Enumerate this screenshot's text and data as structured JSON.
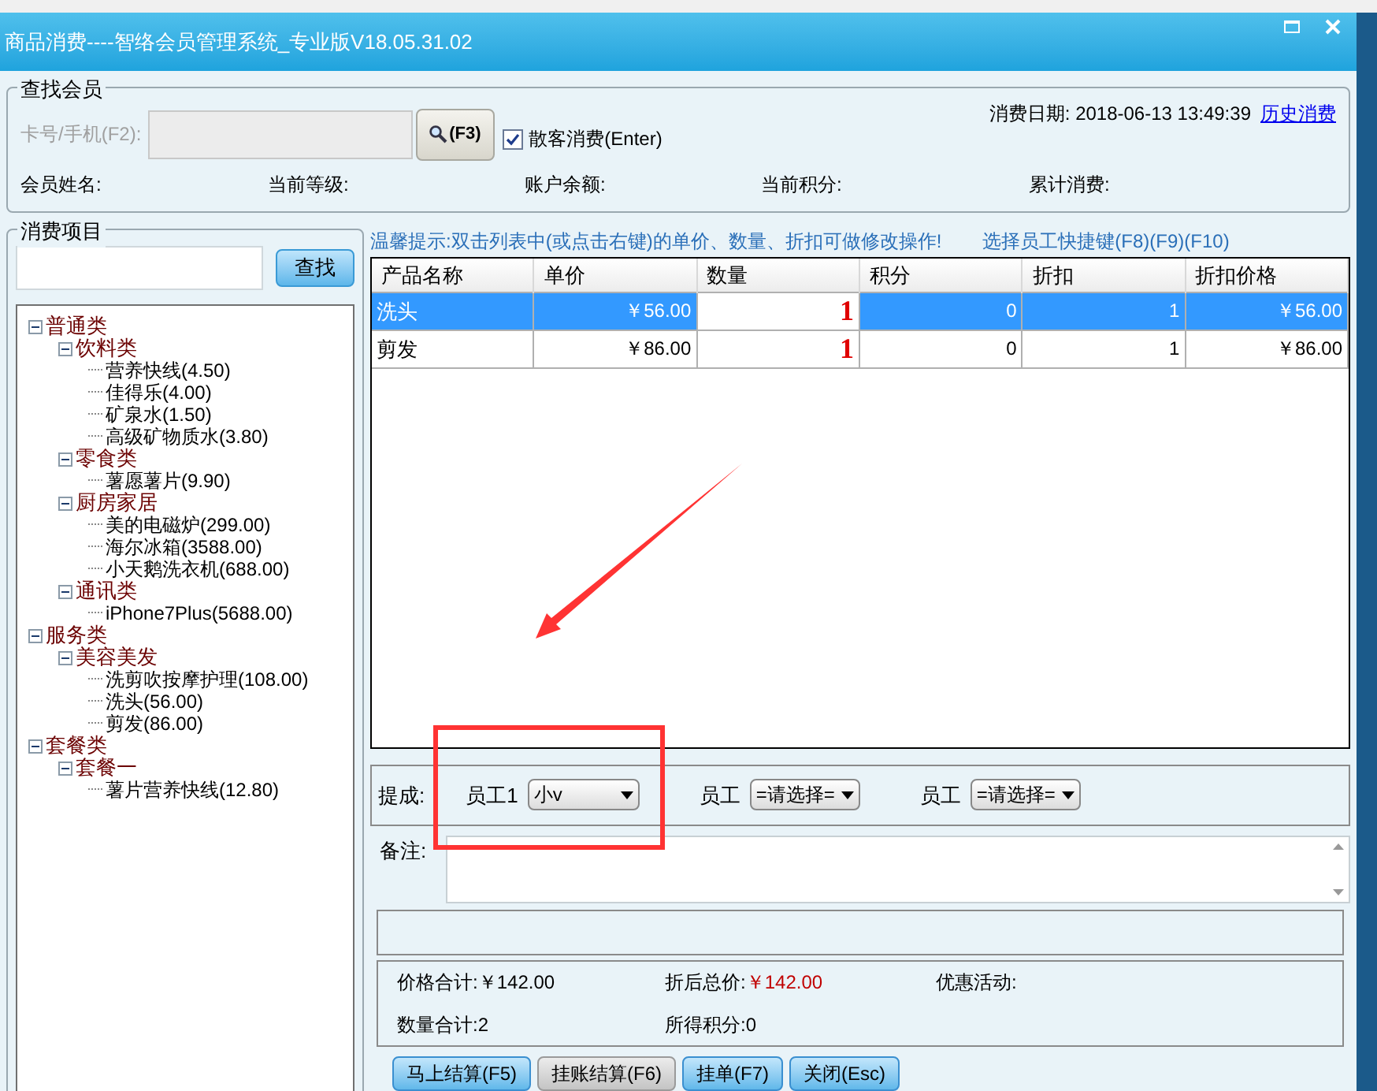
{
  "window": {
    "title": "商品消费----智络会员管理系统_专业版V18.05.31.02"
  },
  "member_search": {
    "group_title": "查找会员",
    "card_label": "卡号/手机(F2):",
    "card_disabled": true,
    "search_button": "(F3)",
    "walk_in": {
      "label": "散客消费(Enter)",
      "checked": true
    },
    "date_label": "消费日期:",
    "date": "2018-06-13 13:49:39",
    "history_link": "历史消费",
    "fields": [
      "会员姓名:",
      "当前等级:",
      "账户余额:",
      "当前积分:",
      "累计消费:"
    ]
  },
  "items_panel": {
    "title": "消费项目",
    "search_button": "查找",
    "tree": [
      {
        "label": "普通类",
        "expanded": true,
        "children": [
          {
            "label": "饮料类",
            "expanded": true,
            "children": [
              {
                "label": "营养快线(4.50)"
              },
              {
                "label": "佳得乐(4.00)"
              },
              {
                "label": "矿泉水(1.50)"
              },
              {
                "label": "高级矿物质水(3.80)"
              }
            ]
          },
          {
            "label": "零食类",
            "expanded": true,
            "children": [
              {
                "label": "薯愿薯片(9.90)"
              }
            ]
          },
          {
            "label": "厨房家居",
            "expanded": true,
            "children": [
              {
                "label": "美的电磁炉(299.00)"
              },
              {
                "label": "海尔冰箱(3588.00)"
              },
              {
                "label": "小天鹅洗衣机(688.00)"
              }
            ]
          },
          {
            "label": "通讯类",
            "expanded": true,
            "children": [
              {
                "label": "iPhone7Plus(5688.00)"
              }
            ]
          }
        ]
      },
      {
        "label": "服务类",
        "expanded": true,
        "children": [
          {
            "label": "美容美发",
            "expanded": true,
            "children": [
              {
                "label": "洗剪吹按摩护理(108.00)"
              },
              {
                "label": "洗头(56.00)"
              },
              {
                "label": "剪发(86.00)"
              }
            ]
          }
        ]
      },
      {
        "label": "套餐类",
        "expanded": true,
        "children": [
          {
            "label": "套餐一",
            "expanded": true,
            "children": [
              {
                "label": "薯片营养快线(12.80)"
              }
            ]
          }
        ]
      }
    ]
  },
  "hint": "温馨提示:双击列表中(或点击右键)的单价、数量、折扣可做修改操作!",
  "shortcut_hint": "选择员工快捷键(F8)(F9)(F10)",
  "table": {
    "columns": [
      "产品名称",
      "单价",
      "数量",
      "积分",
      "折扣",
      "折扣价格"
    ],
    "rows": [
      {
        "selected": true,
        "cells": [
          "洗头",
          "￥56.00",
          "1",
          "0",
          "1",
          "￥56.00"
        ]
      },
      {
        "selected": false,
        "cells": [
          "剪发",
          "￥86.00",
          "1",
          "0",
          "1",
          "￥86.00"
        ]
      }
    ]
  },
  "commission": {
    "label": "提成:",
    "staff": [
      {
        "label": "员工1",
        "value": "小v"
      },
      {
        "label": "员工",
        "value": "=请选择="
      },
      {
        "label": "员工",
        "value": "=请选择="
      }
    ]
  },
  "notes": {
    "label": "备注:"
  },
  "summary": [
    {
      "label": "价格合计:",
      "value": "￥142.00",
      "highlight": false
    },
    {
      "label": "折后总价:",
      "value": "￥142.00",
      "highlight": true
    },
    {
      "label": "优惠活动:"
    },
    {
      "label": "数量合计:",
      "value": "2",
      "highlight": false
    },
    {
      "label": "所得积分:",
      "value": "0",
      "highlight": false
    }
  ],
  "buttons": [
    {
      "label": "马上结算(F5)",
      "kind": "primary"
    },
    {
      "label": "挂账结算(F6)",
      "kind": "secondary"
    },
    {
      "label": "挂单(F7)",
      "kind": "primary"
    },
    {
      "label": "关闭(Esc)",
      "kind": "primary"
    }
  ]
}
